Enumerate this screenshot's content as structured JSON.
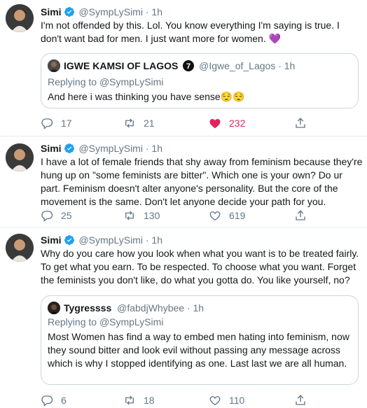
{
  "colors": {
    "accent": "#1da1f2",
    "like": "#e0245e",
    "muted": "#657786",
    "text": "#14171a",
    "border": "#e6ecf0"
  },
  "tweets": [
    {
      "name": "Simi",
      "handle": "@SympLySimi",
      "sep": "·",
      "time": "1h",
      "text": "I'm not offended by this. Lol. You know everything I'm saying is true. I don't want bad for men. I just want more for women. 💜",
      "quote": {
        "name": "IGWE KAMSI OF LAGOS",
        "badge": "7",
        "handle": "@Igwe_of_Lagos",
        "sep": "·",
        "time": "1h",
        "replying_label": "Replying to",
        "replying_handle": "@SympLySimi",
        "text": "And here i was thinking you have sense😌😌"
      },
      "replies": "17",
      "retweets": "21",
      "likes": "232"
    },
    {
      "name": "Simi",
      "handle": "@SympLySimi",
      "sep": "·",
      "time": "1h",
      "text": "I have a lot of female friends that shy away from feminism because they're hung up on \"some feminists are bitter\". Which one is your own? Do ur part. Feminism doesn't alter anyone's personality. But the core of the movement is the same. Don't let anyone decide your path for you.",
      "replies": "25",
      "retweets": "130",
      "likes": "619"
    },
    {
      "name": "Simi",
      "handle": "@SympLySimi",
      "sep": "·",
      "time": "1h",
      "text": "Why do you care how you look when what you want is to be treated fairly. To get what you earn. To be respected. To choose what you want. Forget the feminists you don't like, do what you gotta do. You like yourself, no?",
      "quote": {
        "name": "Tygressss",
        "handle": "@fabdjWhybee",
        "sep": "·",
        "time": "1h",
        "replying_label": "Replying to",
        "replying_handle": "@SympLySimi",
        "text": "Most Women has find a way to embed men hating into feminism, now they sound bitter and look evil without passing any message across which is why I stopped identifying as one. Last last we are all human."
      },
      "replies": "6",
      "retweets": "18",
      "likes": "110"
    }
  ]
}
